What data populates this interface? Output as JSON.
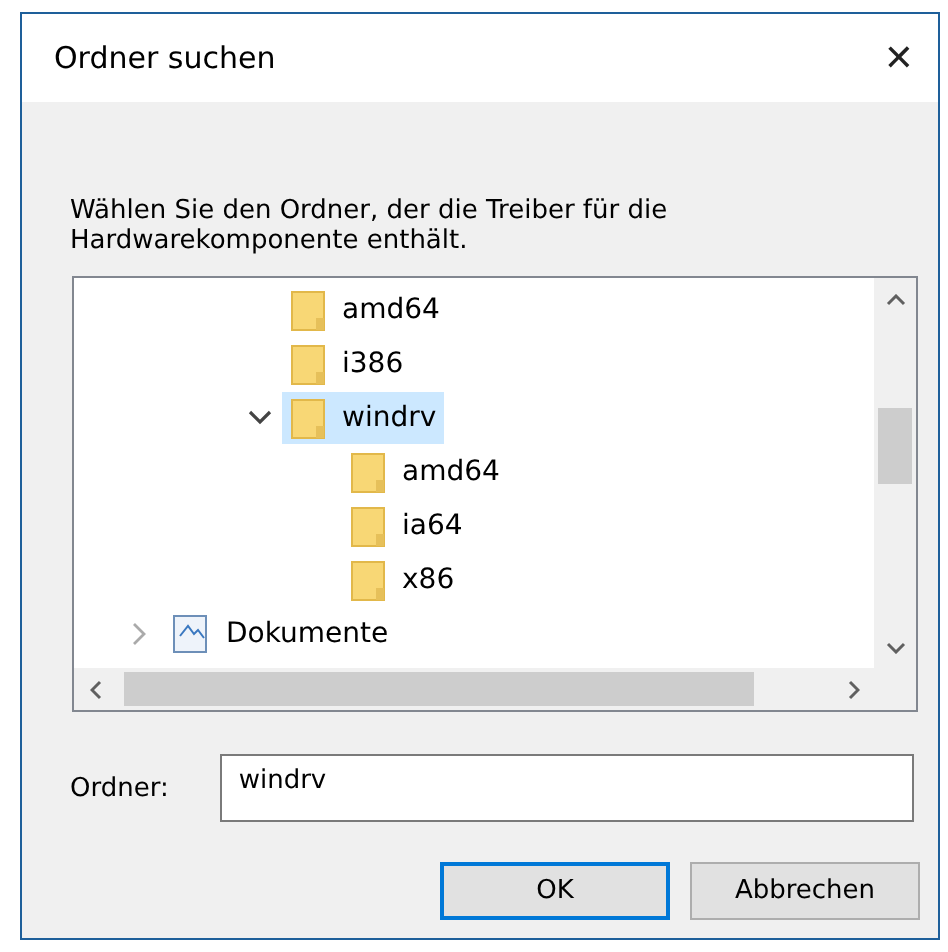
{
  "window": {
    "title": "Ordner suchen",
    "close": "✕"
  },
  "description": "Wählen Sie den Ordner, der die Treiber für die Hardwarekomponente enthält.",
  "tree": {
    "scrolled_branch": [
      {
        "label": "amd64",
        "kind": "folder",
        "selected": false
      },
      {
        "label": "i386",
        "kind": "folder",
        "selected": false
      },
      {
        "label": "windrv",
        "kind": "folder",
        "selected": true,
        "expanded": true,
        "children": [
          {
            "label": "amd64",
            "kind": "folder",
            "selected": false
          },
          {
            "label": "ia64",
            "kind": "folder",
            "selected": false
          },
          {
            "label": "x86",
            "kind": "folder",
            "selected": false
          }
        ]
      }
    ],
    "items": [
      {
        "label": "Dokumente",
        "kind": "library",
        "selected": false,
        "expanded": false
      }
    ]
  },
  "folder_field": {
    "label": "Ordner:",
    "value": "windrv"
  },
  "buttons": [
    {
      "label": "OK",
      "default": true
    },
    {
      "label": "Abbrechen",
      "default": false
    }
  ]
}
